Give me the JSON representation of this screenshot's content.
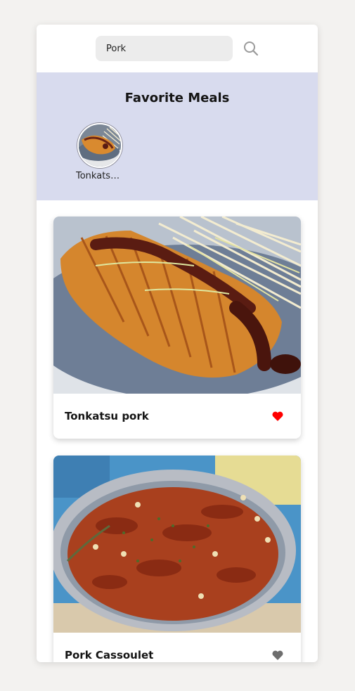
{
  "search": {
    "value": "Pork",
    "placeholder": "Search meals",
    "icon": "search-icon"
  },
  "favorites": {
    "title": "Favorite Meals",
    "items": [
      {
        "name": "Tonkatsu pork"
      }
    ]
  },
  "meals": [
    {
      "name": "Tonkatsu pork",
      "favorited": true,
      "heart_color": "#ff0000"
    },
    {
      "name": "Pork Cassoulet",
      "favorited": false,
      "heart_color": "#6e6e6e"
    }
  ],
  "colors": {
    "favorites_bg": "#d8dbee",
    "page_bg": "#f3f2f0",
    "heart_active": "#ff0000",
    "heart_inactive": "#6e6e6e"
  }
}
